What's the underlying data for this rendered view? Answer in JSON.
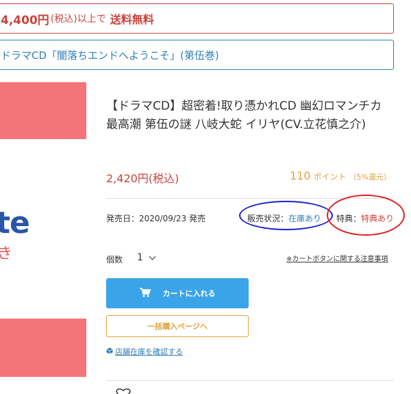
{
  "shipping_banner": {
    "amount": "4,400円",
    "tax": "(税込)",
    "above": "以上で",
    "free": "送料無料"
  },
  "series_banner": {
    "text": "ドラマCD「闇落ちエンドへようこそ」(第伍巻)"
  },
  "product_image": {
    "logo_text": "te",
    "logo_sub": "き"
  },
  "product": {
    "title": "【ドラマCD】超密着!取り憑かれCD 幽幻ロマンチカ 最高潮 第伍の謎 八岐大蛇 イリヤ(CV.立花慎之介)",
    "price": "2,420円(税込)",
    "points_value": "110",
    "points_label": "ポイント",
    "points_rate": "（5%還元）",
    "release": "発売日：2020/09/23 発売",
    "stock_label": "販売状況：",
    "stock_value": "在庫あり",
    "bonus_label": "特典：",
    "bonus_value": "特典あり"
  },
  "purchase": {
    "qty_label": "個数",
    "qty_value": "1",
    "cart_notice": "※カートボタンに関する注意事項",
    "cart_button": "カートに入れる",
    "bulk_button": "一括購入ページへ",
    "store_link": "店舗在庫を確認する"
  },
  "colors": {
    "accent_red": "#c9443d",
    "accent_blue": "#2f7fb6",
    "cart_blue": "#3aa4e8",
    "points_orange": "#e0a23a",
    "image_pink": "#f47478"
  },
  "icons": {
    "cart": "cart-icon",
    "store": "cube-icon",
    "favorite": "heart-icon",
    "qty": "chevron-down-icon"
  }
}
